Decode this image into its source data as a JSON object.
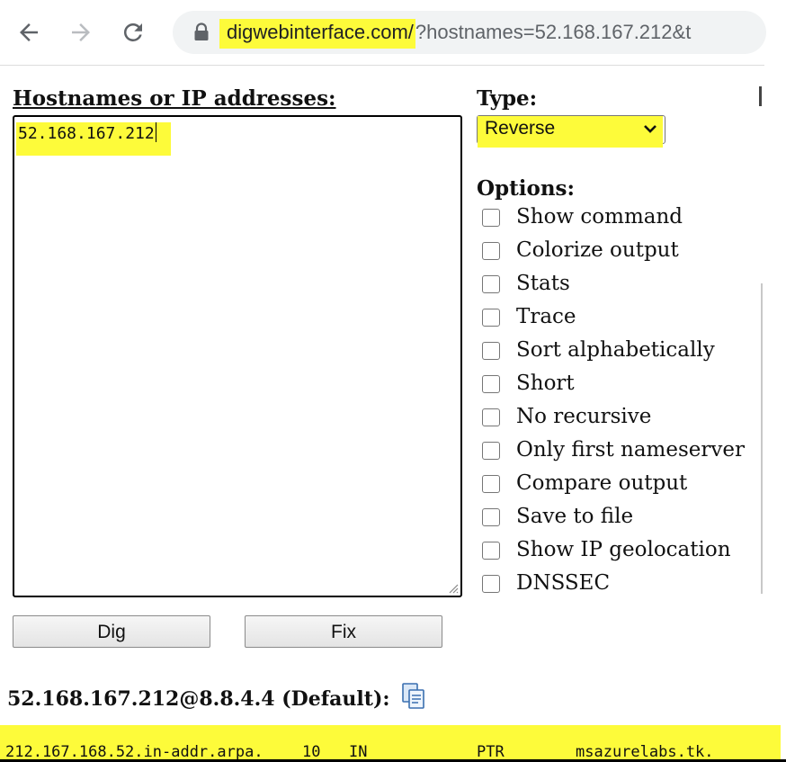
{
  "browser": {
    "url_host": "digwebinterface.com/",
    "url_rest": "?hostnames=52.168.167.212&t",
    "icons": [
      "back-arrow-icon",
      "forward-arrow-icon",
      "reload-icon",
      "lock-icon"
    ]
  },
  "form": {
    "hostnames_label": "Hostnames or IP addresses:",
    "hostnames_value": "52.168.167.212",
    "type_label": "Type:",
    "type_value": "Reverse",
    "options_label": "Options:",
    "options": [
      {
        "label": "Show command",
        "checked": false
      },
      {
        "label": "Colorize output",
        "checked": false
      },
      {
        "label": "Stats",
        "checked": false
      },
      {
        "label": "Trace",
        "checked": false
      },
      {
        "label": "Sort alphabetically",
        "checked": false
      },
      {
        "label": "Short",
        "checked": false
      },
      {
        "label": "No recursive",
        "checked": false
      },
      {
        "label": "Only first nameserver",
        "checked": false
      },
      {
        "label": "Compare output",
        "checked": false
      },
      {
        "label": "Save to file",
        "checked": false
      },
      {
        "label": "Show IP geolocation",
        "checked": false
      },
      {
        "label": "DNSSEC",
        "checked": false
      }
    ],
    "dig_label": "Dig",
    "fix_label": "Fix"
  },
  "result": {
    "header": "52.168.167.212@8.8.4.4 (Default):",
    "row": {
      "name": "212.167.168.52.in-addr.arpa.",
      "ttl": "10",
      "class": "IN",
      "type": "PTR",
      "value": "msazurelabs.tk."
    }
  },
  "colors": {
    "highlight": "#fdfb3a",
    "address_bar": "#f1f3f4"
  }
}
